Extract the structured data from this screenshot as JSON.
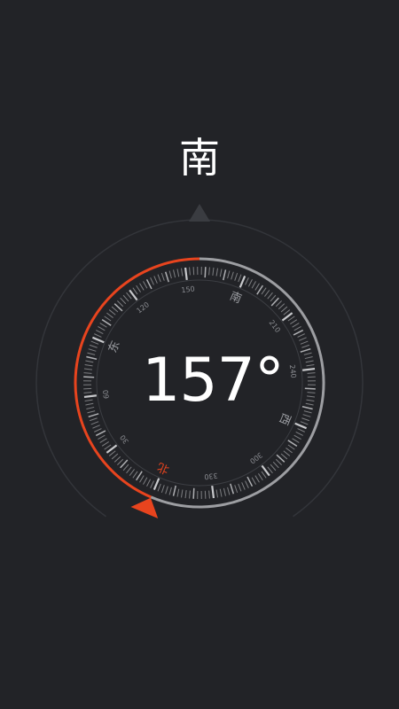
{
  "direction": "南",
  "heading": "157°",
  "heading_value": 157,
  "dial": {
    "degree_labels": [
      {
        "text": "30",
        "angle": 30
      },
      {
        "text": "60",
        "angle": 60
      },
      {
        "text": "120",
        "angle": 120
      },
      {
        "text": "150",
        "angle": 150
      },
      {
        "text": "210",
        "angle": 210
      },
      {
        "text": "240",
        "angle": 240
      },
      {
        "text": "300",
        "angle": 300
      },
      {
        "text": "330",
        "angle": 330
      }
    ],
    "cardinals": [
      {
        "text": "北",
        "angle": 0,
        "name": "north"
      },
      {
        "text": "东",
        "angle": 90,
        "name": "east"
      },
      {
        "text": "南",
        "angle": 180,
        "name": "south"
      },
      {
        "text": "西",
        "angle": 270,
        "name": "west"
      }
    ]
  },
  "colors": {
    "background": "#222327",
    "accent": "#e8441e",
    "dial_ring": "#9d9ea2",
    "ticks": "#c8c9cc",
    "outer_ring": "#33353a",
    "pointer": "#3a3c41"
  }
}
